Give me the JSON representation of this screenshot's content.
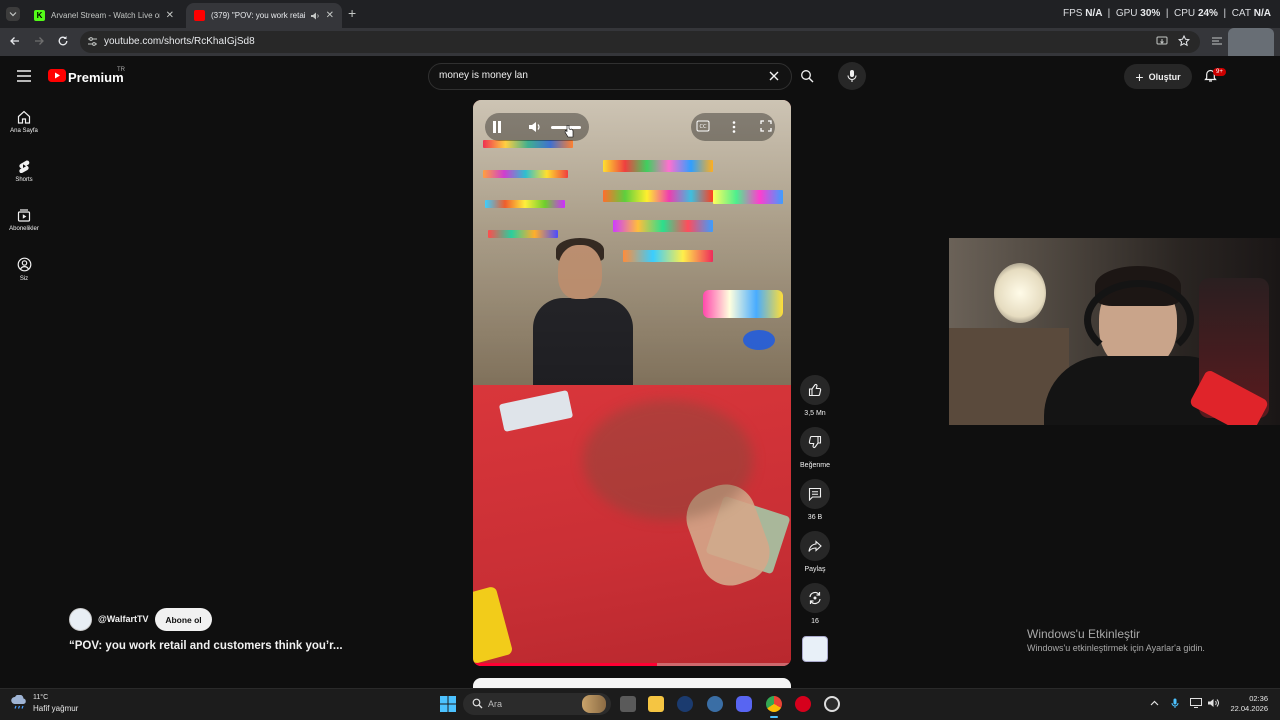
{
  "browser": {
    "tabs": [
      {
        "title": "Arvanel Stream - Watch Live on",
        "favicon_color": "#53fc18",
        "active": false
      },
      {
        "title": "(379) \"POV: you work retail",
        "favicon_color": "#ff0000",
        "active": true
      }
    ],
    "new_tab_label": "+",
    "url": "youtube.com/shorts/RcKhaIGjSd8",
    "hud": {
      "fps_label": "FPS",
      "fps_value": "N/A",
      "gpu_label": "GPU",
      "gpu_value": "30%",
      "cpu_label": "CPU",
      "cpu_value": "24%",
      "cat_label": "CAT",
      "cat_value": "N/A"
    }
  },
  "youtube": {
    "logo": "Premium",
    "logo_region": "TR",
    "search_value": "money is money lan",
    "create_label": "Oluştur",
    "notification_badge": "9+",
    "sidebar": [
      {
        "label": "Ana Sayfa",
        "icon": "home-icon"
      },
      {
        "label": "Shorts",
        "icon": "shorts-icon"
      },
      {
        "label": "Abonelikler",
        "icon": "subscriptions-icon"
      },
      {
        "label": "Siz",
        "icon": "you-icon"
      }
    ],
    "short": {
      "channel": "@WalfartTV",
      "subscribe_label": "Abone ol",
      "title": "“POV: you work retail and customers think you’r...",
      "progress_fraction": 0.58,
      "actions": {
        "likes": "3,5 Mn",
        "dislike_label": "Beğenme",
        "comments": "36 B",
        "share_label": "Paylaş",
        "remix": "16"
      }
    }
  },
  "windows": {
    "activate_title": "Windows'u Etkinleştir",
    "activate_sub": "Windows'u etkinleştirmek için Ayarlar'a gidin.",
    "weather_temp": "11°C",
    "weather_desc": "Hafif yağmur",
    "search_placeholder": "Ara",
    "time": "02:36",
    "date": "22.04.2026"
  },
  "colors": {
    "youtube_red": "#ff0000",
    "accent_blue": "#3ea6ff",
    "bg": "#0f0f0f"
  }
}
